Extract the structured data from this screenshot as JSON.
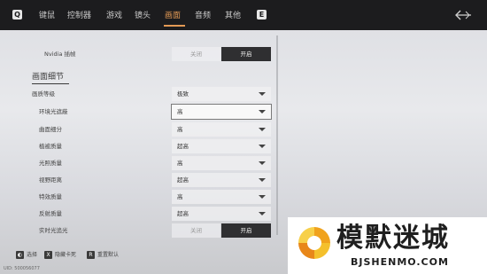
{
  "topbar": {
    "left_key": "Q",
    "right_key": "E",
    "tabs": [
      {
        "label": "键鼠",
        "active": false
      },
      {
        "label": "控制器",
        "active": false
      },
      {
        "label": "游戏",
        "active": false
      },
      {
        "label": "镜头",
        "active": false
      },
      {
        "label": "画面",
        "active": true
      },
      {
        "label": "音频",
        "active": false
      },
      {
        "label": "其他",
        "active": false
      }
    ],
    "accent_color": "#e39a55"
  },
  "nvidia_row": {
    "label": "Nvidia 插帧",
    "off_label": "关闭",
    "on_label": "开启",
    "selected": "开启"
  },
  "section": {
    "title": "画面细节"
  },
  "settings": [
    {
      "label": "画质等级",
      "value": "极致",
      "type": "dropdown"
    },
    {
      "label": "环境光遮蔽",
      "value": "高",
      "type": "dropdown",
      "focused": true
    },
    {
      "label": "曲面细分",
      "value": "高",
      "type": "dropdown"
    },
    {
      "label": "植被质量",
      "value": "超高",
      "type": "dropdown"
    },
    {
      "label": "光照质量",
      "value": "高",
      "type": "dropdown"
    },
    {
      "label": "视野距离",
      "value": "超高",
      "type": "dropdown"
    },
    {
      "label": "特效质量",
      "value": "高",
      "type": "dropdown"
    },
    {
      "label": "反射质量",
      "value": "超高",
      "type": "dropdown"
    }
  ],
  "raytrace_row": {
    "label": "实时光追光",
    "off_label": "关闭",
    "on_label": "开启",
    "selected": "开启"
  },
  "footer": {
    "items": [
      {
        "key": "◐",
        "label": "选择"
      },
      {
        "key": "X",
        "label": "隐藏卡死"
      },
      {
        "key": "R",
        "label": "重置默认"
      }
    ],
    "uid": "UID: 500056077"
  },
  "watermark": {
    "main": "模默迷城",
    "sub": "BJSHENMO.COM"
  }
}
